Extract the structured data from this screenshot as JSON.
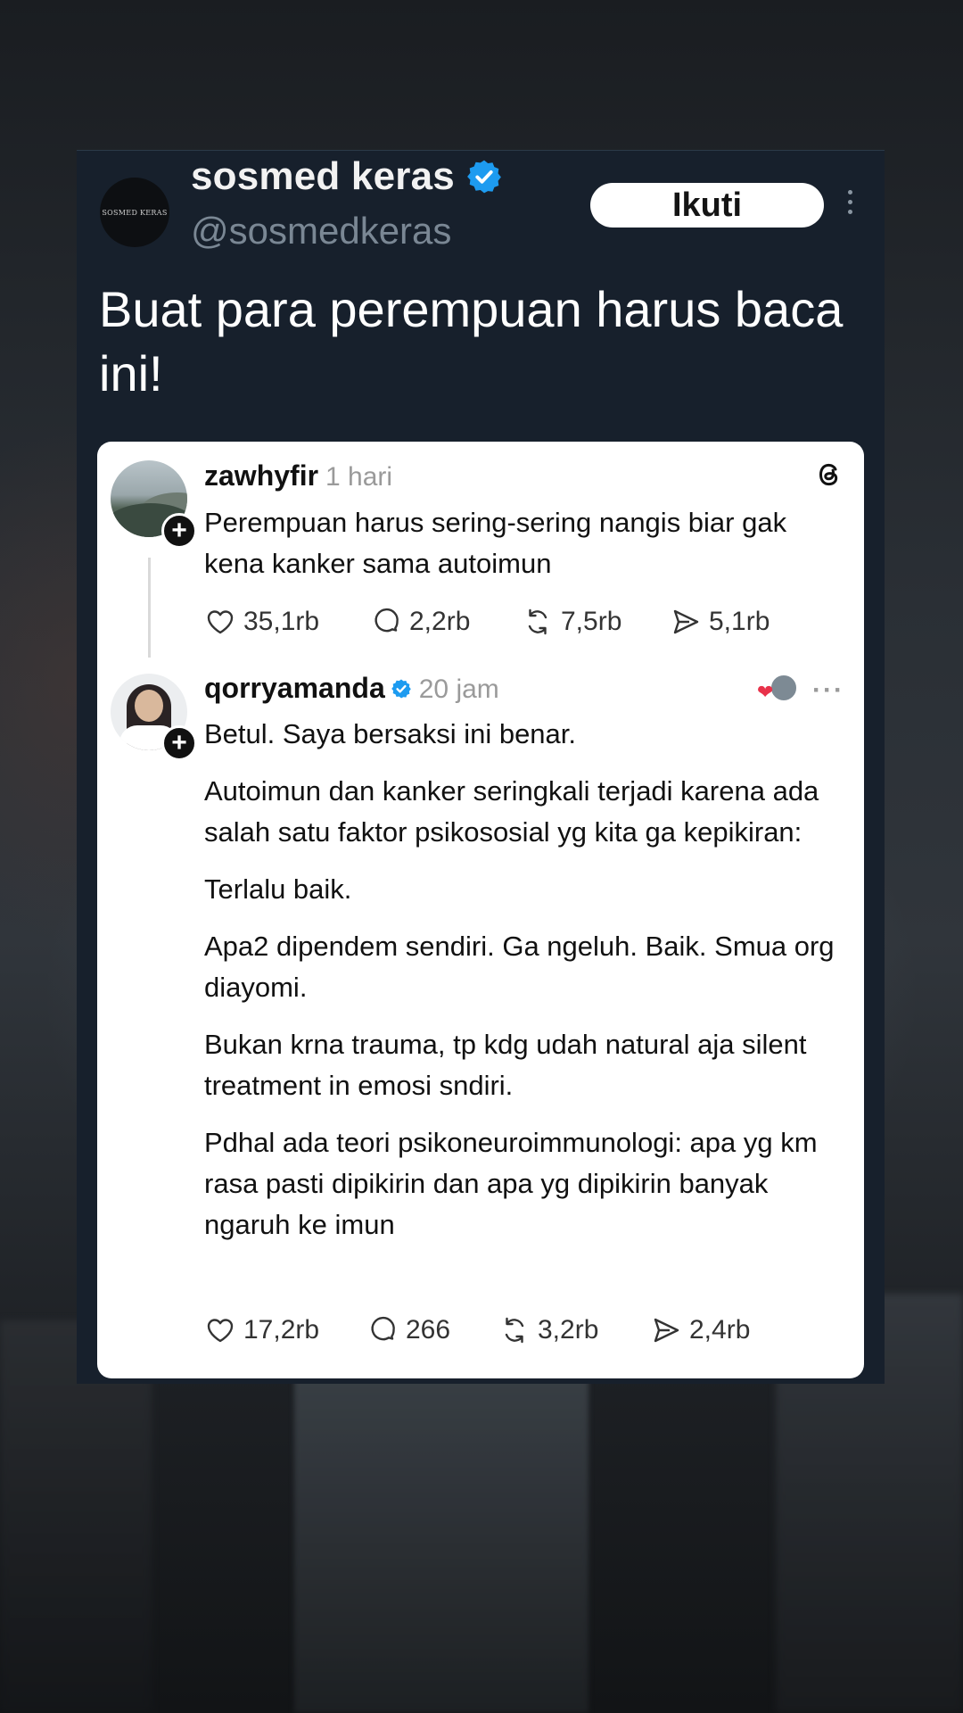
{
  "tweet": {
    "avatar_text": "SOSMED KERAS",
    "display_name": "sosmed keras",
    "handle": "@sosmedkeras",
    "follow_label": "Ikuti",
    "text": "Buat para perempuan harus baca ini!"
  },
  "threads": {
    "post1": {
      "username": "zawhyfir",
      "time": "1 hari",
      "text": "Perempuan harus sering-sering nangis biar gak kena kanker sama autoimun",
      "likes": "35,1rb",
      "replies": "2,2rb",
      "reposts": "7,5rb",
      "shares": "5,1rb"
    },
    "post2": {
      "username": "qorryamanda",
      "time": "20 jam",
      "paragraphs": [
        "Betul. Saya bersaksi ini benar.",
        "Autoimun dan kanker seringkali terjadi karena ada salah satu faktor psikososial yg kita ga kepikiran:",
        "Terlalu baik.",
        "Apa2 dipendem sendiri. Ga ngeluh. Baik. Smua org diayomi.",
        "Bukan krna trauma, tp kdg udah natural aja silent treatment in emosi sndiri.",
        "Pdhal ada teori psikoneuroimmunologi: apa yg km rasa pasti dipikirin dan apa yg dipikirin banyak ngaruh ke imun"
      ],
      "more_label": "···",
      "likes": "17,2rb",
      "replies": "266",
      "reposts": "3,2rb",
      "shares": "2,4rb"
    }
  },
  "icons": {
    "verified": "verified-badge-icon",
    "threads": "threads-logo-icon",
    "like": "heart-icon",
    "reply": "comment-icon",
    "repost": "repost-icon",
    "share": "send-icon"
  },
  "colors": {
    "tweet_bg": "#17202c",
    "verified": "#1d9bf0",
    "card_bg": "#ffffff"
  }
}
